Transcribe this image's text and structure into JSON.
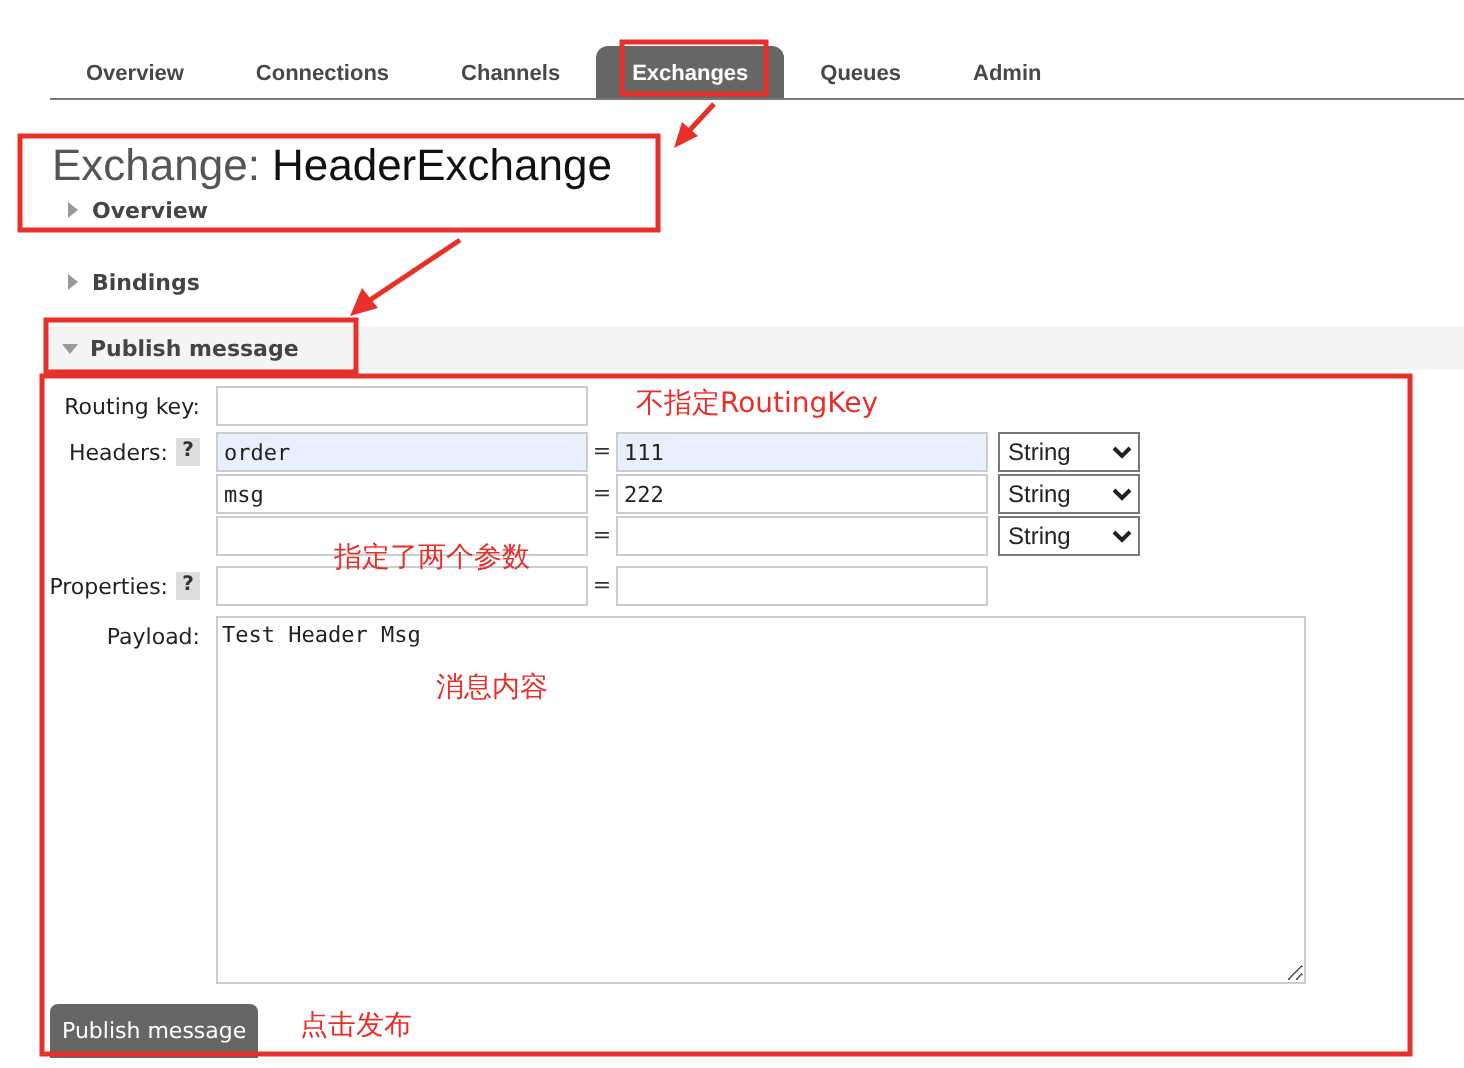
{
  "tabs": [
    {
      "label": "Overview",
      "selected": false
    },
    {
      "label": "Connections",
      "selected": false
    },
    {
      "label": "Channels",
      "selected": false
    },
    {
      "label": "Exchanges",
      "selected": true
    },
    {
      "label": "Queues",
      "selected": false
    },
    {
      "label": "Admin",
      "selected": false
    }
  ],
  "heading": {
    "prefix": "Exchange:",
    "name": "HeaderExchange"
  },
  "sections": [
    {
      "label": "Overview",
      "expanded": false
    },
    {
      "label": "Bindings",
      "expanded": false
    },
    {
      "label": "Publish message",
      "expanded": true
    }
  ],
  "form": {
    "routing_key": {
      "label": "Routing key:"
    },
    "headers": {
      "label": "Headers:",
      "help": "?",
      "rows": [
        {
          "key": "order",
          "separator": "=",
          "value": "111",
          "type": "String",
          "highlighted": true
        },
        {
          "key": "msg",
          "separator": "=",
          "value": "222",
          "type": "String",
          "highlighted": false
        },
        {
          "separator": "=",
          "type": "String",
          "highlighted": false
        }
      ]
    },
    "properties": {
      "label": "Properties:",
      "help": "?",
      "separator": "="
    },
    "payload": {
      "label": "Payload:",
      "value": "Test Header Msg"
    },
    "submit": "Publish message"
  },
  "annotations": [
    {
      "text": "不指定RoutingKey"
    },
    {
      "text": "指定了两个参数"
    },
    {
      "text": "消息内容"
    },
    {
      "text": "点击发布"
    }
  ]
}
